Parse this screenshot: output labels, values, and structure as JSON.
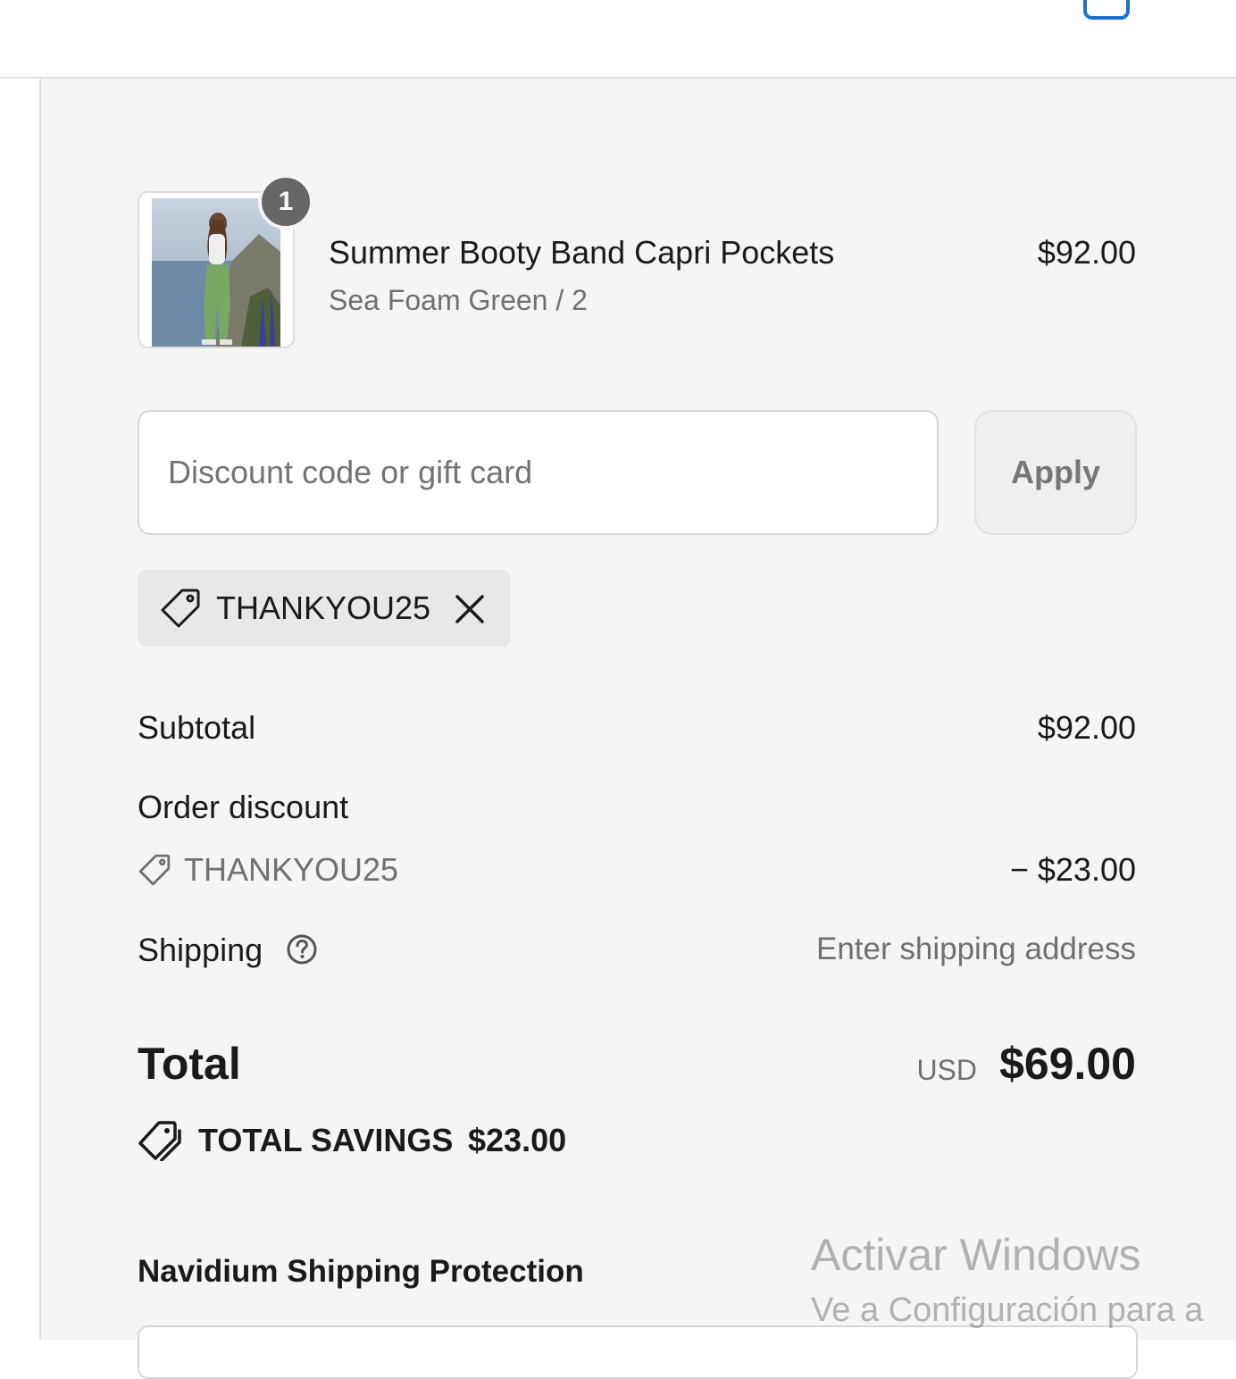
{
  "cart": {
    "item_count": "1"
  },
  "line_item": {
    "name": "Summer Booty Band Capri Pockets",
    "variant": "Sea Foam Green / 2",
    "price": "$92.00",
    "quantity": "1"
  },
  "discount": {
    "placeholder": "Discount code or gift card",
    "value": "",
    "apply_label": "Apply",
    "applied_code": "THANKYOU25"
  },
  "summary": {
    "subtotal_label": "Subtotal",
    "subtotal_value": "$92.00",
    "order_discount_label": "Order discount",
    "order_discount_code": "THANKYOU25",
    "order_discount_value": "− $23.00",
    "shipping_label": "Shipping",
    "shipping_value": "Enter shipping address",
    "total_label": "Total",
    "total_currency": "USD",
    "total_value": "$69.00",
    "savings_label": "TOTAL SAVINGS",
    "savings_value": "$23.00"
  },
  "protection": {
    "title": "Navidium Shipping Protection"
  },
  "watermark": {
    "title": "Activar Windows",
    "subtitle": "Ve a Configuración para a"
  },
  "icons": {
    "cart": "bag-icon",
    "tag": "tag-icon",
    "remove": "close-icon",
    "help": "question-circle-icon",
    "savings": "tags-icon"
  },
  "colors": {
    "summary_bg": "#f5f5f5",
    "badge": "#666666",
    "muted_text": "#707070",
    "cart_icon": "#1f6fd1"
  }
}
